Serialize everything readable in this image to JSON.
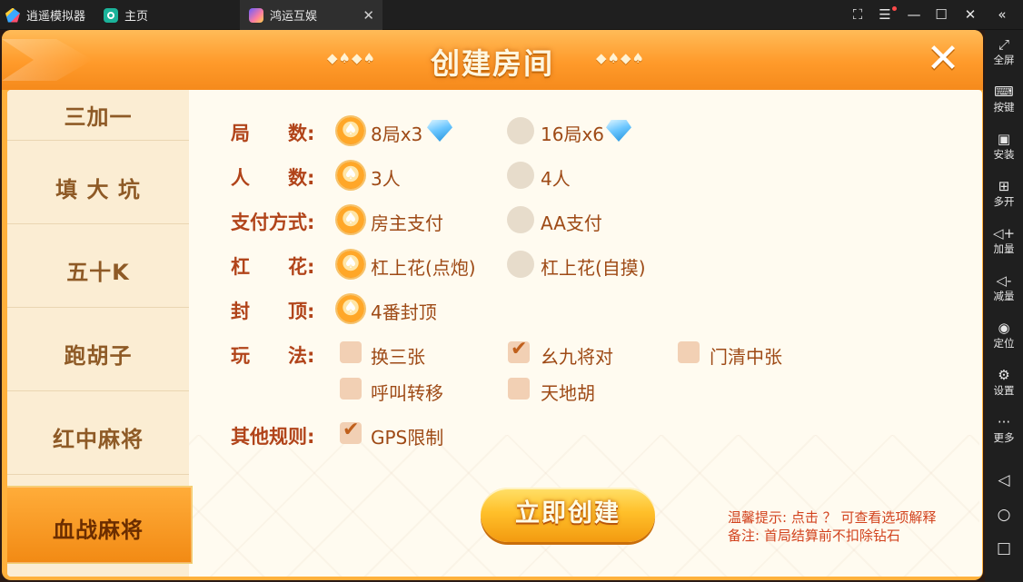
{
  "emulator": {
    "app_name": "逍遥模拟器",
    "tabs": [
      {
        "label": "主页"
      },
      {
        "label": "鸿运互娱",
        "close": "✕"
      }
    ],
    "sidebar": [
      {
        "icon": "fullscreen-icon",
        "label": "全屏"
      },
      {
        "icon": "keyboard-icon",
        "label": "按键"
      },
      {
        "icon": "apk-install-icon",
        "label": "安装"
      },
      {
        "icon": "multi-open-icon",
        "label": "多开"
      },
      {
        "icon": "volume-up-icon",
        "label": "加量"
      },
      {
        "icon": "volume-down-icon",
        "label": "减量"
      },
      {
        "icon": "location-icon",
        "label": "定位"
      },
      {
        "icon": "settings-icon",
        "label": "设置"
      },
      {
        "icon": "more-icon",
        "label": "更多"
      }
    ]
  },
  "dialog": {
    "title": "创建房间",
    "deco_left": "◆♠◆♠",
    "deco_right": "◆♠◆♠"
  },
  "nav": [
    {
      "label": "三加一",
      "active": false
    },
    {
      "label": "填 大 坑",
      "active": false
    },
    {
      "label": "五十K",
      "active": false
    },
    {
      "label": "跑胡子",
      "active": false
    },
    {
      "label": "红中麻将",
      "active": false
    },
    {
      "label": "血战麻将",
      "active": true
    }
  ],
  "options": {
    "rounds": {
      "label": "局　　数:",
      "choices": [
        {
          "text": "8局x3",
          "selected": true
        },
        {
          "text": "16局x6",
          "selected": false
        }
      ]
    },
    "players": {
      "label": "人　　数:",
      "choices": [
        {
          "text": "3人",
          "selected": true
        },
        {
          "text": "4人",
          "selected": false
        }
      ]
    },
    "payment": {
      "label": "支付方式:",
      "choices": [
        {
          "text": "房主支付",
          "selected": true
        },
        {
          "text": "AA支付",
          "selected": false
        }
      ]
    },
    "gang_hua": {
      "label": "杠　　花:",
      "choices": [
        {
          "text": "杠上花(点炮)",
          "selected": true
        },
        {
          "text": "杠上花(自摸)",
          "selected": false
        }
      ]
    },
    "cap": {
      "label": "封　　顶:",
      "choices": [
        {
          "text": "4番封顶",
          "selected": true
        }
      ]
    },
    "play": {
      "label": "玩　　法:",
      "choices": [
        {
          "text": "换三张",
          "checked": false
        },
        {
          "text": "幺九将对",
          "checked": true
        },
        {
          "text": "门清中张",
          "checked": false
        },
        {
          "text": "呼叫转移",
          "checked": false
        },
        {
          "text": "天地胡",
          "checked": false
        }
      ]
    },
    "other": {
      "label": "其他规则:",
      "choices": [
        {
          "text": "GPS限制",
          "checked": true
        }
      ]
    }
  },
  "create_button": "立即创建",
  "hint_line1": "温馨提示: 点击 ？ 可查看选项解释",
  "hint_line2": "备注: 首局结算前不扣除钻石"
}
